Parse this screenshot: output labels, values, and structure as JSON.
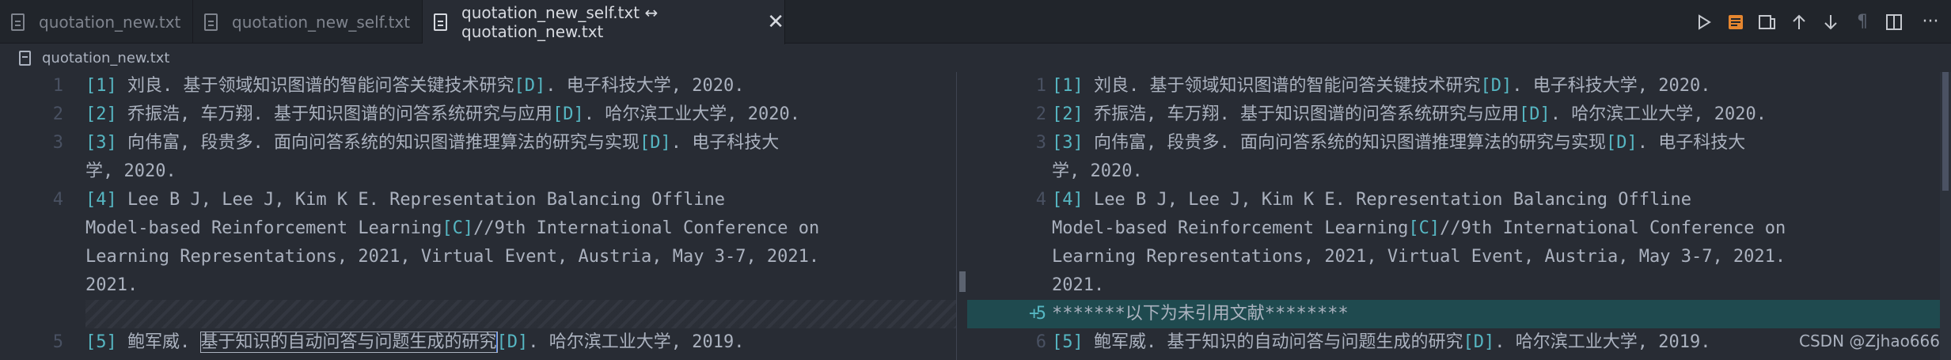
{
  "tabs": [
    {
      "label": "quotation_new.txt",
      "active": false
    },
    {
      "label": "quotation_new_self.txt",
      "active": false
    },
    {
      "label": "quotation_new_self.txt ↔ quotation_new.txt",
      "active": true,
      "close": "✕"
    }
  ],
  "toolbar": {
    "icons": [
      "run-icon",
      "open-preview-icon",
      "open-changes-icon",
      "previous-change-icon",
      "next-change-icon",
      "whitespace-icon",
      "split-editor-icon",
      "more-actions-icon"
    ],
    "whitespace_glyph": "¶",
    "more_glyph": "···"
  },
  "breadcrumb": {
    "file": "quotation_new.txt"
  },
  "left_pane": {
    "lines": [
      {
        "num": "1",
        "parts": [
          "[1]",
          " 刘良. 基于领域知识图谱的智能问答关键技术研究",
          "[D]",
          ". 电子科技大学, 2020."
        ]
      },
      {
        "num": "2",
        "parts": [
          "[2]",
          " 乔振浩, 车万翔. 基于知识图谱的问答系统研究与应用",
          "[D]",
          ". 哈尔滨工业大学, 2020."
        ]
      },
      {
        "num": "3",
        "parts": [
          "[3]",
          " 向伟富, 段贵多. 面向问答系统的知识图谱推理算法的研究与实现",
          "[D]",
          ". 电子科技大"
        ]
      },
      {
        "num": "",
        "text": "学, 2020."
      },
      {
        "num": "4",
        "parts": [
          "[4]",
          " Lee B J, Lee J, Kim K E. Representation Balancing Offline"
        ]
      },
      {
        "num": "",
        "parts": [
          "Model-based Reinforcement Learning",
          "[C]",
          "//9th International Conference on"
        ]
      },
      {
        "num": "",
        "text": "Learning Representations, 2021, Virtual Event, Austria, May 3-7, 2021."
      },
      {
        "num": "",
        "text": "2021."
      },
      {
        "num": "5",
        "prefix": "[5]",
        "name": " 鲍军威. ",
        "selected": "基于知识的自动问答与问题生成的研究",
        "ref": "[D]",
        "tail": ". 哈尔滨工业大学, 2019."
      }
    ]
  },
  "right_pane": {
    "lines": [
      {
        "num": "1",
        "parts": [
          "[1]",
          " 刘良. 基于领域知识图谱的智能问答关键技术研究",
          "[D]",
          ". 电子科技大学, 2020."
        ]
      },
      {
        "num": "2",
        "parts": [
          "[2]",
          " 乔振浩, 车万翔. 基于知识图谱的问答系统研究与应用",
          "[D]",
          ". 哈尔滨工业大学, 2020."
        ]
      },
      {
        "num": "3",
        "parts": [
          "[3]",
          " 向伟富, 段贵多. 面向问答系统的知识图谱推理算法的研究与实现",
          "[D]",
          ". 电子科技大"
        ]
      },
      {
        "num": "",
        "text": "学, 2020."
      },
      {
        "num": "4",
        "parts": [
          "[4]",
          " Lee B J, Lee J, Kim K E. Representation Balancing Offline"
        ]
      },
      {
        "num": "",
        "parts": [
          "Model-based Reinforcement Learning",
          "[C]",
          "//9th International Conference on"
        ]
      },
      {
        "num": "",
        "text": "Learning Representations, 2021, Virtual Event, Austria, May 3-7, 2021."
      },
      {
        "num": "",
        "text": "2021."
      },
      {
        "num": "5",
        "plus": "+",
        "text": "*******以下为未引用文献********",
        "inserted": true
      },
      {
        "num": "6",
        "parts": [
          "[5]",
          " 鲍军威. 基于知识的自动问答与问题生成的研究",
          "[D]",
          ". 哈尔滨工业大学, 2019."
        ]
      }
    ]
  },
  "watermark": "CSDN @Zjhao666",
  "colors": {
    "bracket": "#56b6c2",
    "insert_band": "#1f4a4f",
    "background": "#282c34",
    "tabbar": "#21252b"
  }
}
